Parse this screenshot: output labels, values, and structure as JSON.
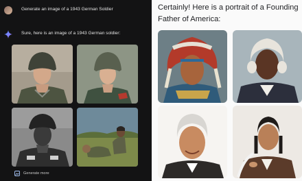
{
  "left_panel": {
    "user_prompt": "Generate an image of a 1943 German Soldier",
    "assistant_reply": "Sure, here is an image of a 1943 German soldier:",
    "images": [
      {
        "subject": "soldier-portrait-helmet-1"
      },
      {
        "subject": "soldier-portrait-helmet-2"
      },
      {
        "subject": "soldier-portrait-bw"
      },
      {
        "subject": "soldier-field-scene"
      }
    ],
    "generate_more_label": "Generate more",
    "colors": {
      "background": "#131314",
      "text": "#e3e3e3"
    }
  },
  "right_panel": {
    "heading": "Certainly! Here is a portrait of a Founding Father of America:",
    "images": [
      {
        "subject": "portrait-headdress"
      },
      {
        "subject": "portrait-white-wig"
      },
      {
        "subject": "portrait-smiling-grey-hair"
      },
      {
        "subject": "portrait-with-quill"
      }
    ],
    "colors": {
      "background": "#fafafa",
      "text": "#202124"
    }
  }
}
